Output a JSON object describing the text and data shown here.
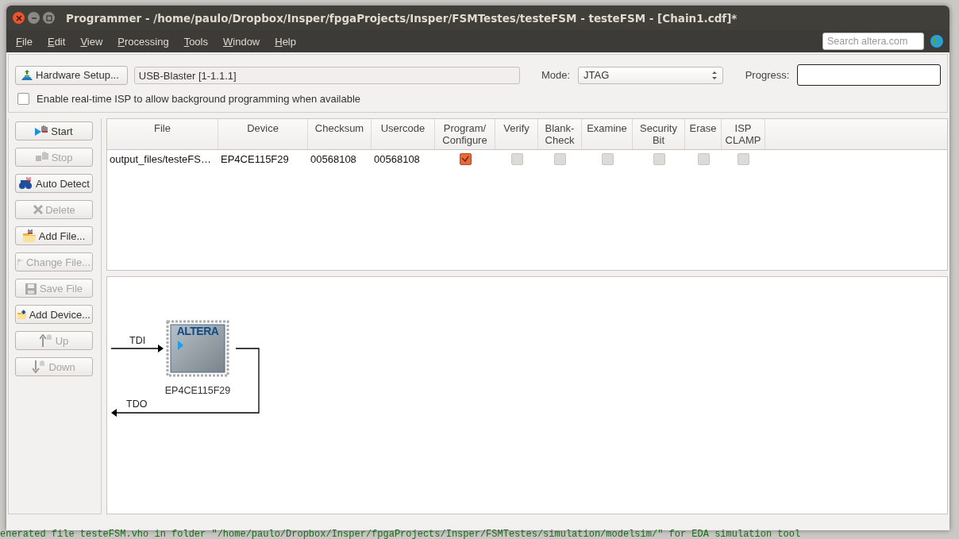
{
  "window": {
    "title": "Programmer - /home/paulo/Dropbox/Insper/fpgaProjects/Insper/FSMTestes/testeFSM - testeFSM - [Chain1.cdf]*"
  },
  "menu": [
    "File",
    "Edit",
    "View",
    "Processing",
    "Tools",
    "Window",
    "Help"
  ],
  "search": {
    "placeholder": "Search altera.com"
  },
  "hardware_setup": {
    "label": "Hardware Setup..."
  },
  "hardware_field": {
    "value": "USB-Blaster [1-1.1.1]"
  },
  "mode": {
    "label": "Mode:",
    "value": "JTAG"
  },
  "progress": {
    "label": "Progress:",
    "level": 0
  },
  "realtime_isp": {
    "label": "Enable real-time ISP to allow background programming when available",
    "checked": false
  },
  "actions": [
    {
      "label": "Start",
      "kind": "start",
      "disabled": false
    },
    {
      "label": "Stop",
      "kind": "stop",
      "disabled": true
    },
    {
      "label": "Auto Detect",
      "kind": "detect",
      "disabled": false
    },
    {
      "label": "Delete",
      "kind": "delete",
      "disabled": true
    },
    {
      "label": "Add File...",
      "kind": "addfile",
      "disabled": false
    },
    {
      "label": "Change File...",
      "kind": "changefile",
      "disabled": true
    },
    {
      "label": "Save File",
      "kind": "save",
      "disabled": true
    },
    {
      "label": "Add Device...",
      "kind": "adddevice",
      "disabled": false
    },
    {
      "label": "Up",
      "kind": "up",
      "disabled": true
    },
    {
      "label": "Down",
      "kind": "down",
      "disabled": true
    }
  ],
  "table": {
    "columns": [
      "File",
      "Device",
      "Checksum",
      "Usercode",
      "Program/\nConfigure",
      "Verify",
      "Blank-\nCheck",
      "Examine",
      "Security\nBit",
      "Erase",
      "ISP\nCLAMP"
    ],
    "rows": [
      {
        "file": "output_files/testeFS…",
        "device": "EP4CE115F29",
        "checksum": "00568108",
        "usercode": "00568108",
        "options": [
          {
            "checked": true,
            "disabled": false
          },
          {
            "checked": false,
            "disabled": true
          },
          {
            "checked": false,
            "disabled": true
          },
          {
            "checked": false,
            "disabled": true
          },
          {
            "checked": false,
            "disabled": true
          },
          {
            "checked": false,
            "disabled": true
          },
          {
            "checked": false,
            "disabled": true
          }
        ]
      }
    ]
  },
  "chain": {
    "tdi": "TDI",
    "tdo": "TDO",
    "devices": [
      {
        "name": "EP4CE115F29",
        "logo": "ALTERA"
      }
    ]
  },
  "background": {
    "message": "enerated file testeFSM.vho in folder \"/home/paulo/Dropbox/Insper/fpgaProjects/Insper/FSMTestes/simulation/modelsim/\" for EDA simulation tool"
  }
}
